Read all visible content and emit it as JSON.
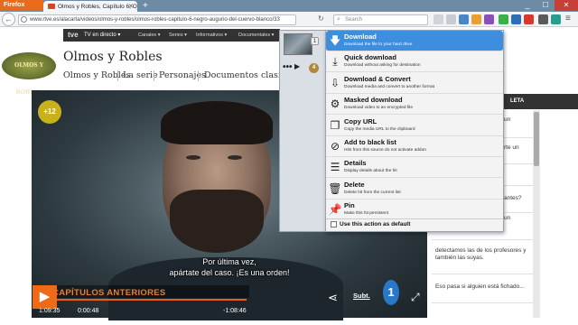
{
  "browser": {
    "app_button": "Firefox",
    "tab_title": "Olmos y Robles, Capítulo 6, Oj...",
    "url": "www.rtve.es/alacarta/videos/olmos-y-robles/olmos-robles-capitulo-6-negro-augurio-del-cuervo-blanco/33",
    "search_placeholder": "Search",
    "new_tab_label": "+",
    "accent_color": "#e86a1a"
  },
  "site": {
    "tve_logo": "tve",
    "tv_directo": "TV en directo ▾",
    "top_nav": [
      "Canales ▾",
      "Series ▾",
      "Informativos ▾",
      "Documentales ▾"
    ],
    "show_logo_text": "OLMOS Y ROBLES",
    "show_title": "Olmos y Robles",
    "sub_nav": [
      "Olmos y Robles",
      "La serie",
      "Personajes",
      "Documentos clasificad"
    ]
  },
  "player": {
    "age_rating": "+12",
    "subtitle_line1": "Por última vez,",
    "subtitle_line2": "apártate del caso. ¡Es una orden!",
    "banner": "N CAPÍTULOS ANTERIORES",
    "total_time": "1:09:35",
    "current_time": "0:00:48",
    "remaining_time": "-1:08:46",
    "subtitles_label": "Subt.",
    "channel_logo": "1",
    "progress_fraction": 1.0
  },
  "sidebar": {
    "header": "LETA",
    "cards": [
      "un",
      "rte un",
      "",
      "antes?",
      "un",
      "detectamos las de los profesores y también las suyas.",
      "Eso pasa si alguien está fichado..."
    ]
  },
  "popup": {
    "thumb_badge": "1",
    "more_label": "•••",
    "play_label": "▶",
    "count": "4",
    "items": [
      {
        "icon": "download-icon",
        "glyph": "🡇",
        "title": "Download",
        "desc": "Download the file to your hard drive",
        "selected": true
      },
      {
        "icon": "quick-download-icon",
        "glyph": "⤓",
        "title": "Quick download",
        "desc": "Download without asking for destination",
        "selected": false
      },
      {
        "icon": "download-convert-icon",
        "glyph": "⇩",
        "title": "Download & Convert",
        "desc": "Download media and convert to another format",
        "selected": false
      },
      {
        "icon": "masked-download-icon",
        "glyph": "⚙",
        "title": "Masked download",
        "desc": "Download video to an encrypted file",
        "selected": false
      },
      {
        "icon": "copy-url-icon",
        "glyph": "❐",
        "title": "Copy URL",
        "desc": "Copy the media URL to the clipboard",
        "selected": false
      },
      {
        "icon": "blacklist-icon",
        "glyph": "⊘",
        "title": "Add to black list",
        "desc": "Hits from this source do not activate addon",
        "selected": false
      },
      {
        "icon": "details-icon",
        "glyph": "☰",
        "title": "Details",
        "desc": "Display details about the hit",
        "selected": false
      },
      {
        "icon": "delete-icon",
        "glyph": "🗑",
        "title": "Delete",
        "desc": "Delete hit from the current list",
        "selected": false
      },
      {
        "icon": "pin-icon",
        "glyph": "📌",
        "title": "Pin",
        "desc": "Make this hit persistent",
        "selected": false
      }
    ],
    "default_action_label": "Use this action as default"
  }
}
